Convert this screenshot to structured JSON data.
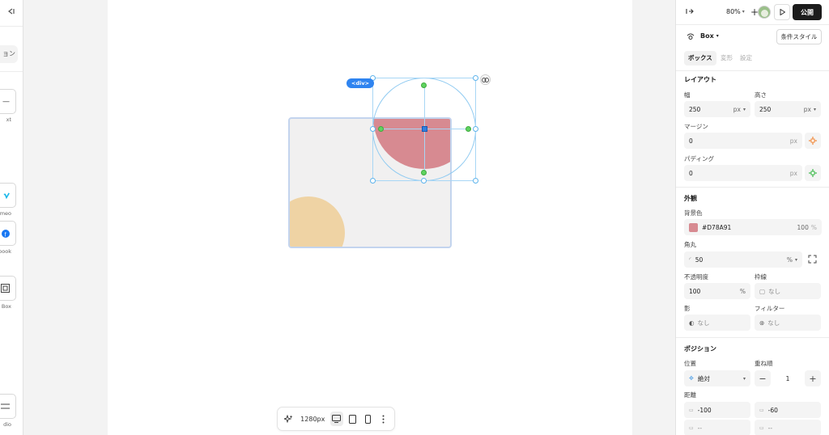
{
  "left_panel": {
    "search_placeholder": "ョン",
    "tiles": [
      {
        "label": "xt",
        "icon": "text-icon"
      },
      {
        "label": "meo",
        "icon": "vimeo-icon"
      },
      {
        "label": "ebook",
        "icon": "facebook-icon"
      },
      {
        "label": "Box",
        "icon": "box-icon"
      },
      {
        "label": "dio",
        "icon": "audio-icon"
      }
    ]
  },
  "canvas": {
    "selection_tag": "<div>",
    "box_background": "#F1F0F0",
    "selected_color": "#D78A91",
    "yellow_color": "#EFD3A4"
  },
  "bottom_bar": {
    "width_label": "1280px"
  },
  "right_panel": {
    "top": {
      "zoom": "80%",
      "publish": "公開"
    },
    "element": {
      "name": "Box",
      "conditional_style": "条件スタイル"
    },
    "tabs": [
      "ボックス",
      "変形",
      "設定"
    ],
    "layout": {
      "title": "レイアウト",
      "width_label": "幅",
      "width_value": "250",
      "width_unit": "px",
      "height_label": "高さ",
      "height_value": "250",
      "height_unit": "px",
      "margin_label": "マージン",
      "margin_value": "0",
      "margin_unit": "px",
      "padding_label": "パディング",
      "padding_value": "0",
      "padding_unit": "px"
    },
    "appearance": {
      "title": "外観",
      "bg_label": "背景色",
      "bg_hex": "#D78A91",
      "bg_opacity": "100",
      "bg_opacity_unit": "%",
      "radius_label": "角丸",
      "radius_value": "50",
      "radius_unit": "%",
      "opacity_label": "不透明度",
      "opacity_value": "100",
      "opacity_unit": "%",
      "border_label": "枠線",
      "border_value": "なし",
      "shadow_label": "影",
      "shadow_value": "なし",
      "filter_label": "フィルター",
      "filter_value": "なし"
    },
    "position": {
      "title": "ポジション",
      "pos_label": "位置",
      "pos_value": "絶対",
      "z_label": "重ね順",
      "z_value": "1",
      "distance_label": "距離",
      "top_value": "-100",
      "right_value": "-60",
      "bottom_value": "--",
      "left_value": "--"
    }
  }
}
